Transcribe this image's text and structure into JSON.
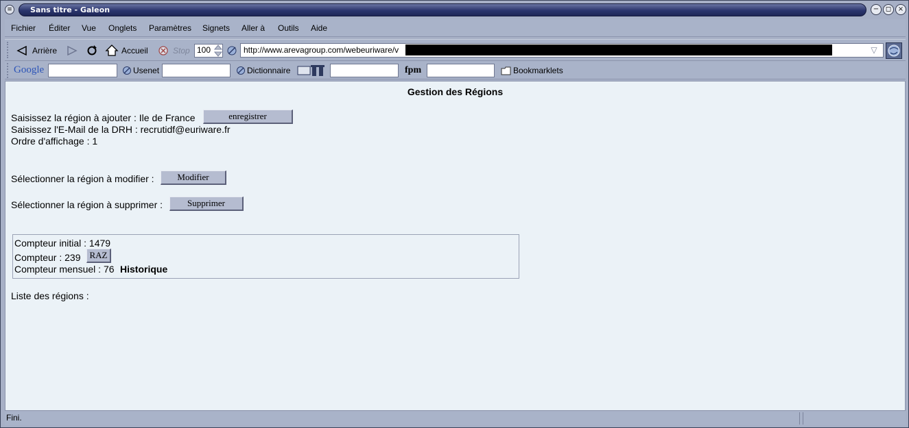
{
  "window": {
    "title": "Sans titre - Galeon"
  },
  "menu": {
    "items": [
      {
        "label": "Fichier"
      },
      {
        "label": "Éditer"
      },
      {
        "label": "Vue"
      },
      {
        "label": "Onglets"
      },
      {
        "label": "Paramètres"
      },
      {
        "label": "Signets"
      },
      {
        "label": "Aller à"
      },
      {
        "label": "Outils"
      },
      {
        "label": "Aide"
      }
    ]
  },
  "toolbar": {
    "back_label": "Arrière",
    "home_label": "Accueil",
    "stop_label": "Stop",
    "zoom_value": "100",
    "url_value": "http://www.arevagroup.com/webeuriware/v"
  },
  "bookmarks": {
    "google_label": "Google",
    "usenet_label": "Usenet",
    "dictionnaire_label": "Dictionnaire",
    "fpm_label": "fpm",
    "bookmarklets_label": "Bookmarklets"
  },
  "page": {
    "title": "Gestion des Régions",
    "add_region_label": "Saisissez la région à ajouter : Ile de France",
    "save_button": "enregistrer",
    "email_label": "Saisissez l'E-Mail de la DRH : recrutidf@euriware.fr",
    "order_label": "Ordre d'affichage : 1",
    "modify_label": "Sélectionner la région à modifier :",
    "modify_button": "Modifier",
    "delete_label": "Sélectionner la région à supprimer :",
    "delete_button": "Supprimer",
    "counter_initial": "Compteur initial : 1479",
    "counter": "Compteur : 239",
    "raz_button": "RAZ",
    "counter_monthly": "Compteur mensuel : 76",
    "history_link": "Historique",
    "regions_list_label": "Liste des régions :"
  },
  "status": {
    "text": "Fini."
  }
}
